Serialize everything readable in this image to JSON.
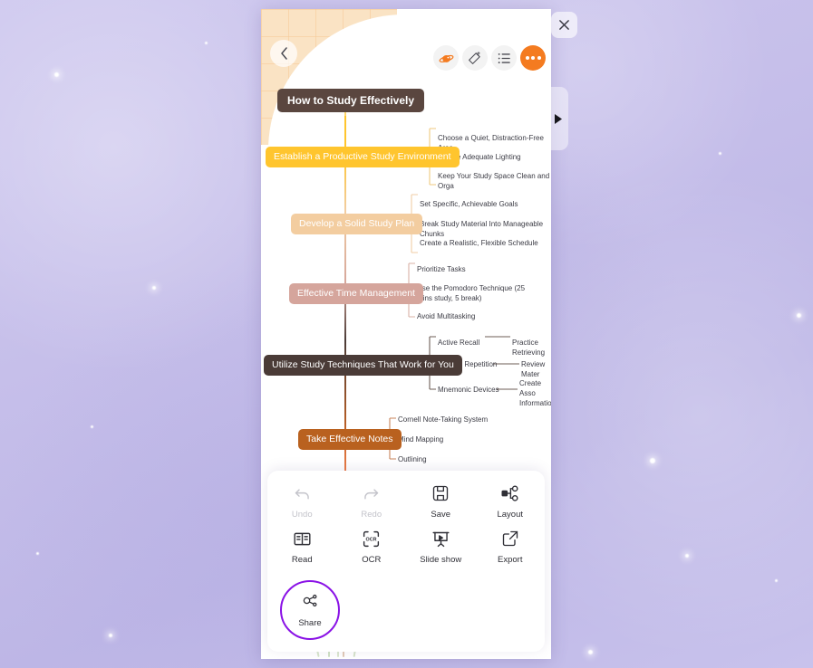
{
  "window": {
    "close_label": "×",
    "expand_label": "▶"
  },
  "topbar": {
    "back_label": "‹",
    "buttons": [
      {
        "name": "ai-assistant",
        "label": ""
      },
      {
        "name": "magic-wand",
        "label": ""
      },
      {
        "name": "outline-list",
        "label": ""
      },
      {
        "name": "more-options",
        "label": ""
      }
    ]
  },
  "mindmap": {
    "title": "How to Study Effectively",
    "branches": [
      {
        "label": "Establish a Productive Study Environment",
        "color": "#ffc52e",
        "children": [
          {
            "label": "Choose a Quiet, Distraction-Free Area"
          },
          {
            "label": "Ensure Adequate Lighting"
          },
          {
            "label": "Keep Your Study Space Clean and Orga"
          }
        ]
      },
      {
        "label": "Develop a Solid Study Plan",
        "color": "#f3cda0",
        "children": [
          {
            "label": "Set Specific, Achievable Goals"
          },
          {
            "label": "Break Study Material Into Manageable Chunks"
          },
          {
            "label": "Create a Realistic, Flexible Schedule"
          }
        ]
      },
      {
        "label": "Effective Time Management",
        "color": "#d5a59c",
        "children": [
          {
            "label": "Prioritize Tasks"
          },
          {
            "label": "Use the Pomodoro Technique (25 mins study, 5 break)"
          },
          {
            "label": "Avoid Multitasking"
          }
        ]
      },
      {
        "label": "Utilize Study Techniques That Work for You",
        "color": "#4a3b37",
        "children": [
          {
            "label": "Active Recall",
            "grandchild": "Practice Retrieving"
          },
          {
            "label": "Spaced Repetition",
            "grandchild": "Review Mater"
          },
          {
            "label": "Mnemonic Devices",
            "grandchild": "Create Asso Information"
          }
        ]
      },
      {
        "label": "Take Effective Notes",
        "color": "#b9611f",
        "children": [
          {
            "label": "Cornell Note-Taking System"
          },
          {
            "label": "Mind Mapping"
          },
          {
            "label": "Outlining"
          }
        ]
      }
    ]
  },
  "actions": [
    {
      "name": "undo",
      "label": "Undo",
      "disabled": true
    },
    {
      "name": "redo",
      "label": "Redo",
      "disabled": true
    },
    {
      "name": "save",
      "label": "Save",
      "disabled": false
    },
    {
      "name": "layout",
      "label": "Layout",
      "disabled": false
    },
    {
      "name": "read",
      "label": "Read",
      "disabled": false
    },
    {
      "name": "ocr",
      "label": "OCR",
      "disabled": false
    },
    {
      "name": "slideshow",
      "label": "Slide show",
      "disabled": false
    },
    {
      "name": "export",
      "label": "Export",
      "disabled": false
    }
  ],
  "share": {
    "label": "Share",
    "ring_color": "#8a12e6"
  }
}
